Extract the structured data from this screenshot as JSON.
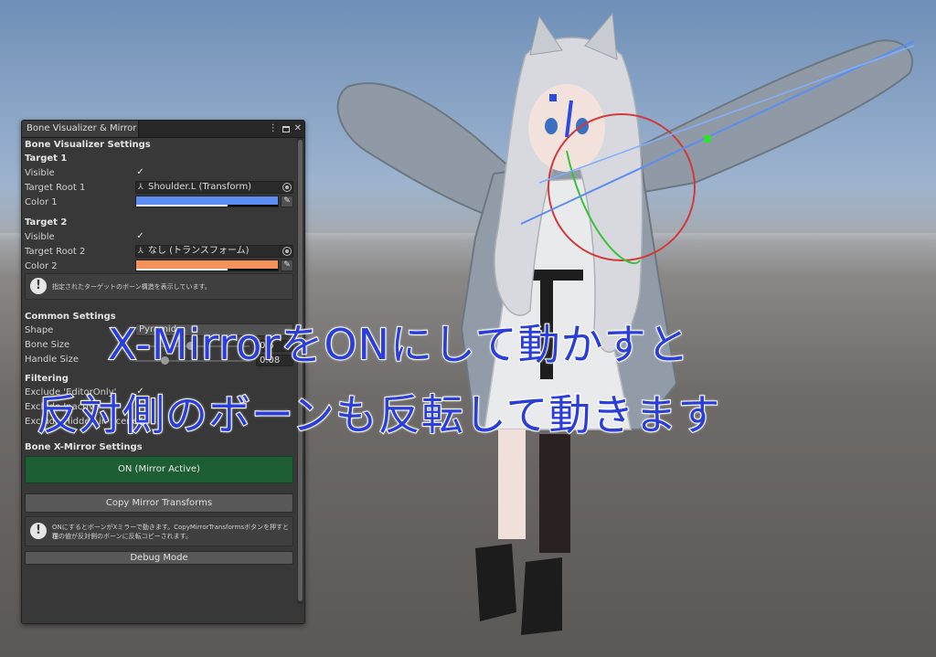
{
  "window": {
    "title": "Bone Visualizer & Mirror",
    "menu_icon": "kebab-menu-icon",
    "maximize_icon": "maximize-icon",
    "close_icon": "close-icon"
  },
  "bone_visualizer": {
    "section_title": "Bone Visualizer Settings",
    "target1": {
      "header": "Target 1",
      "visible_label": "Visible",
      "visible_checked": true,
      "root_label": "Target Root 1",
      "root_value": "Shoulder.L (Transform)",
      "color_label": "Color 1",
      "color": "#5b8ef0"
    },
    "target2": {
      "header": "Target 2",
      "visible_label": "Visible",
      "visible_checked": true,
      "root_label": "Target Root 2",
      "root_value": "なし (トランスフォーム)",
      "color_label": "Color 2",
      "color": "#f5925c"
    },
    "help_text": "指定されたターゲットのボーン構造を表示しています。"
  },
  "common_settings": {
    "header": "Common Settings",
    "shape_label": "Shape",
    "shape_value": "Pyramid",
    "bone_size_label": "Bone Size",
    "bone_size_value": "0.5",
    "handle_size_label": "Handle Size",
    "handle_size_value": "0.08"
  },
  "filtering": {
    "header": "Filtering",
    "exclude_editor_only_label": "Exclude 'EditorOnly'",
    "exclude_inactive_label": "Exclude Inactive",
    "exclude_hidden_label": "Exclude Hidden in Scene"
  },
  "mirror": {
    "section_title": "Bone X-Mirror Settings",
    "toggle_label": "ON (Mirror Active)",
    "copy_button_label": "Copy Mirror Transforms",
    "help_text_line1": "ONにするとボーンがXミラーで動きます。CopyMirrorTransformsボタンを押すと現",
    "help_text_line2": "在の値が反対側のボーンに反転コピーされます。",
    "debug_button_label": "Debug Mode"
  },
  "caption": {
    "line1": "X-MirrorをONにして動かすと",
    "line2": "反対側のボーンも反転して動きます",
    "color": "#2b3ed9"
  }
}
